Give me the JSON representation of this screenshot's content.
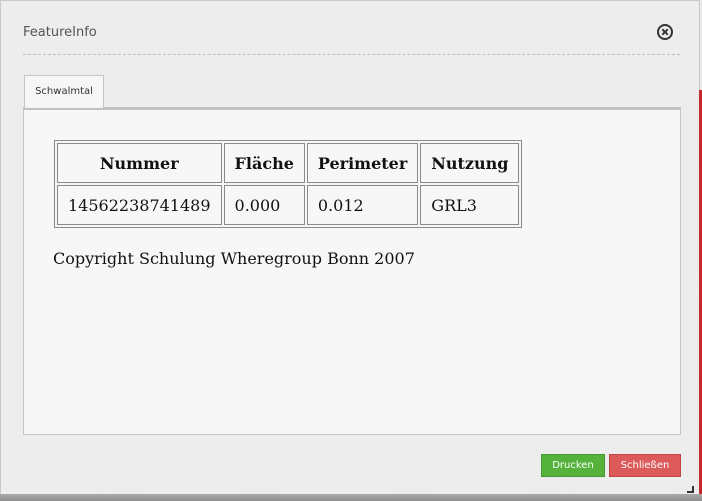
{
  "dialog": {
    "title": "FeatureInfo",
    "close_icon": "close-circle-icon"
  },
  "tabs": [
    {
      "label": "Schwalmtal",
      "active": true
    }
  ],
  "table": {
    "headers": [
      "Nummer",
      "Fläche",
      "Perimeter",
      "Nutzung"
    ],
    "rows": [
      [
        "14562238741489",
        "0.000",
        "0.012",
        "GRL3"
      ]
    ]
  },
  "copyright": "Copyright Schulung Wheregroup Bonn 2007",
  "buttons": {
    "print_label": "Drucken",
    "close_label": "Schließen"
  },
  "colors": {
    "print_button": "#55b33b",
    "close_button": "#dc5a5a"
  },
  "icons": {
    "resize": "resize-handle-icon"
  }
}
